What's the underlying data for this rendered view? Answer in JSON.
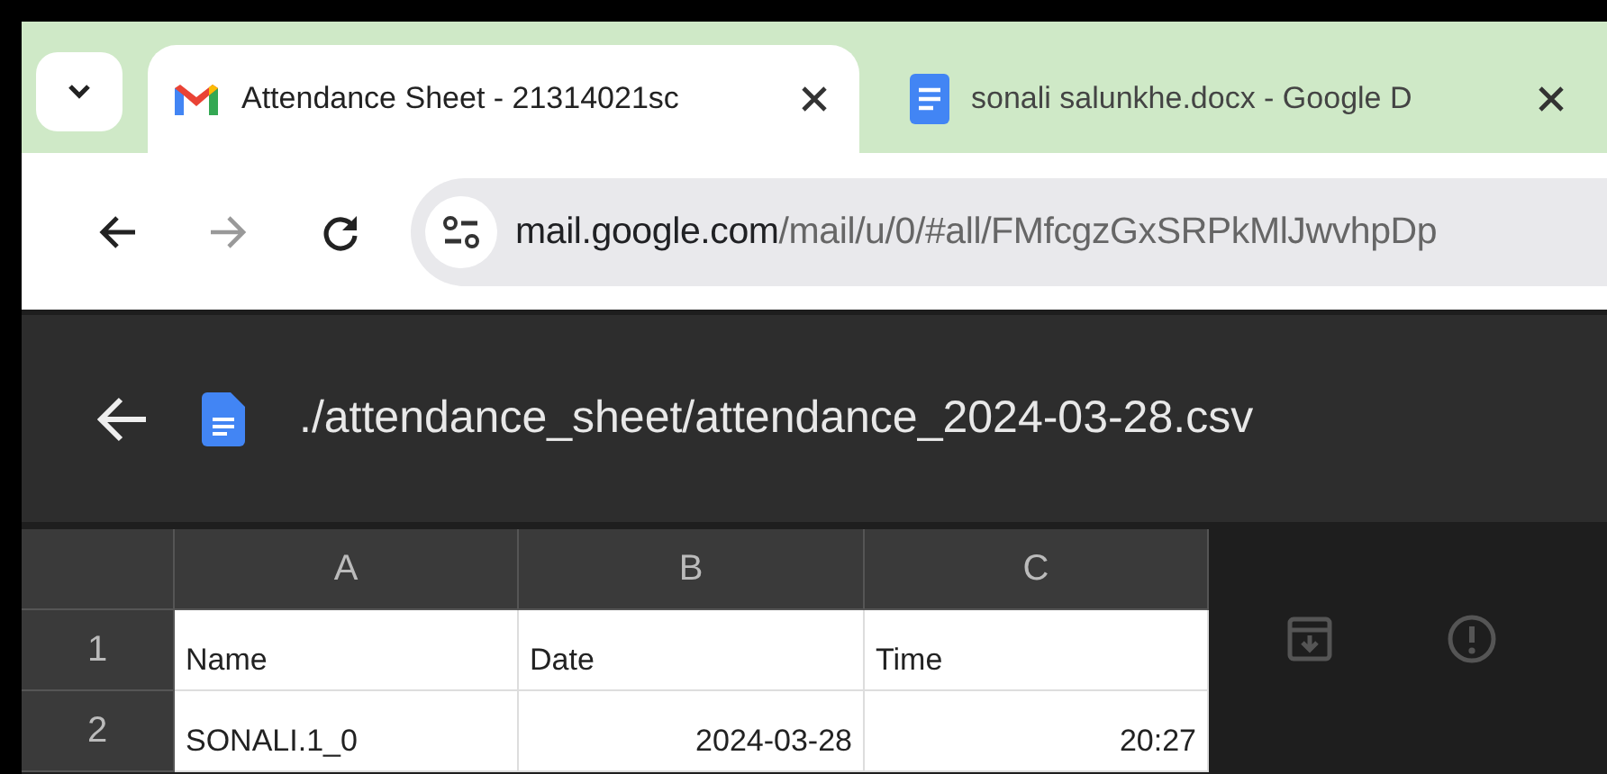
{
  "tabs": [
    {
      "title": "Attendance Sheet - 21314021sc",
      "kind": "mail",
      "selected": true
    },
    {
      "title": "sonali salunkhe.docx - Google D",
      "kind": "doc",
      "selected": false
    }
  ],
  "address_bar": {
    "host": "mail.google.com",
    "path": "/mail/u/0/#all/FMfcgzGxSRPkMlJwvhpDp"
  },
  "viewer": {
    "file_name": "./attendance_sheet/attendance_2024-03-28.csv"
  },
  "sheet": {
    "columns": [
      "A",
      "B",
      "C"
    ],
    "rows": [
      {
        "number": "1",
        "cells": [
          {
            "text": "Name",
            "kind": "text"
          },
          {
            "text": "Date",
            "kind": "text"
          },
          {
            "text": "Time",
            "kind": "text"
          }
        ]
      },
      {
        "number": "2",
        "cells": [
          {
            "text": "SONALI.1_0",
            "kind": "text"
          },
          {
            "text": "2024-03-28",
            "kind": "number"
          },
          {
            "text": "20:27",
            "kind": "number"
          }
        ]
      }
    ]
  }
}
